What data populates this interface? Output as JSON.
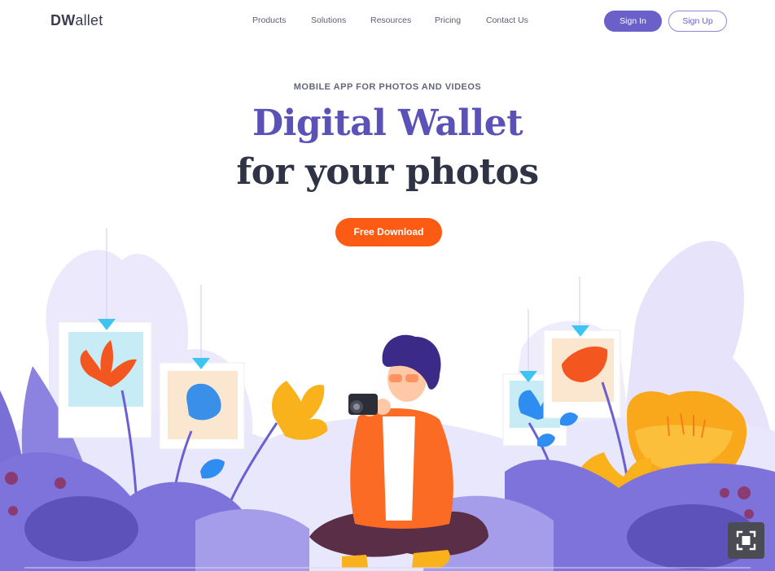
{
  "brand": {
    "logo_bold": "DW",
    "logo_light": "allet"
  },
  "nav": {
    "links": [
      "Products",
      "Solutions",
      "Resources",
      "Pricing",
      "Contact Us"
    ],
    "sign_in": "Sign In",
    "sign_up": "Sign Up"
  },
  "hero": {
    "eyebrow": "MOBILE APP FOR PHOTOS AND VIDEOS",
    "title_line1": "Digital Wallet",
    "title_line2": "for your photos",
    "cta": "Free Download"
  },
  "colors": {
    "accent": "#6a60c9",
    "cta": "#fb5b12",
    "title_accent": "#5a52b8",
    "title_dark": "#2f3345"
  },
  "icons": {
    "fullscreen": "fullscreen-icon"
  }
}
